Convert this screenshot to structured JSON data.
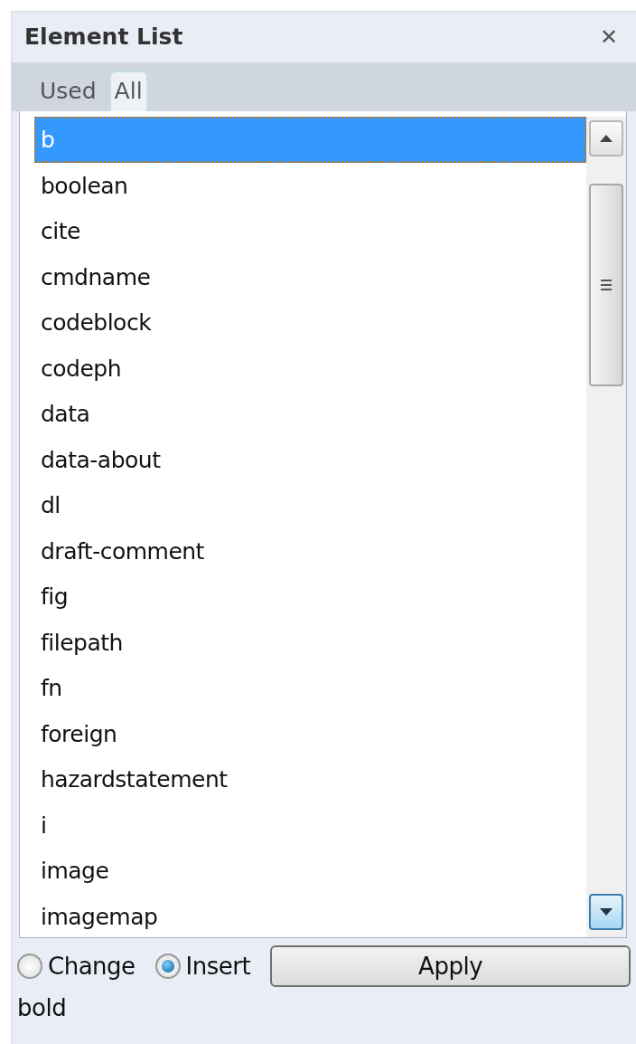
{
  "panel": {
    "title": "Element List",
    "close": "✕"
  },
  "tabs": [
    {
      "label": "Used",
      "selected": false
    },
    {
      "label": "All",
      "selected": true
    }
  ],
  "items": [
    {
      "label": "b",
      "selected": true
    },
    {
      "label": "boolean",
      "selected": false
    },
    {
      "label": "cite",
      "selected": false
    },
    {
      "label": "cmdname",
      "selected": false
    },
    {
      "label": "codeblock",
      "selected": false
    },
    {
      "label": "codeph",
      "selected": false
    },
    {
      "label": "data",
      "selected": false
    },
    {
      "label": "data-about",
      "selected": false
    },
    {
      "label": "dl",
      "selected": false
    },
    {
      "label": "draft-comment",
      "selected": false
    },
    {
      "label": "fig",
      "selected": false
    },
    {
      "label": "filepath",
      "selected": false
    },
    {
      "label": "fn",
      "selected": false
    },
    {
      "label": "foreign",
      "selected": false
    },
    {
      "label": "hazardstatement",
      "selected": false
    },
    {
      "label": "i",
      "selected": false
    },
    {
      "label": "image",
      "selected": false
    },
    {
      "label": "imagemap",
      "selected": false
    }
  ],
  "modes": [
    {
      "label": "Change",
      "selected": false
    },
    {
      "label": "Insert",
      "selected": true
    }
  ],
  "apply_button": "Apply",
  "description": "bold"
}
